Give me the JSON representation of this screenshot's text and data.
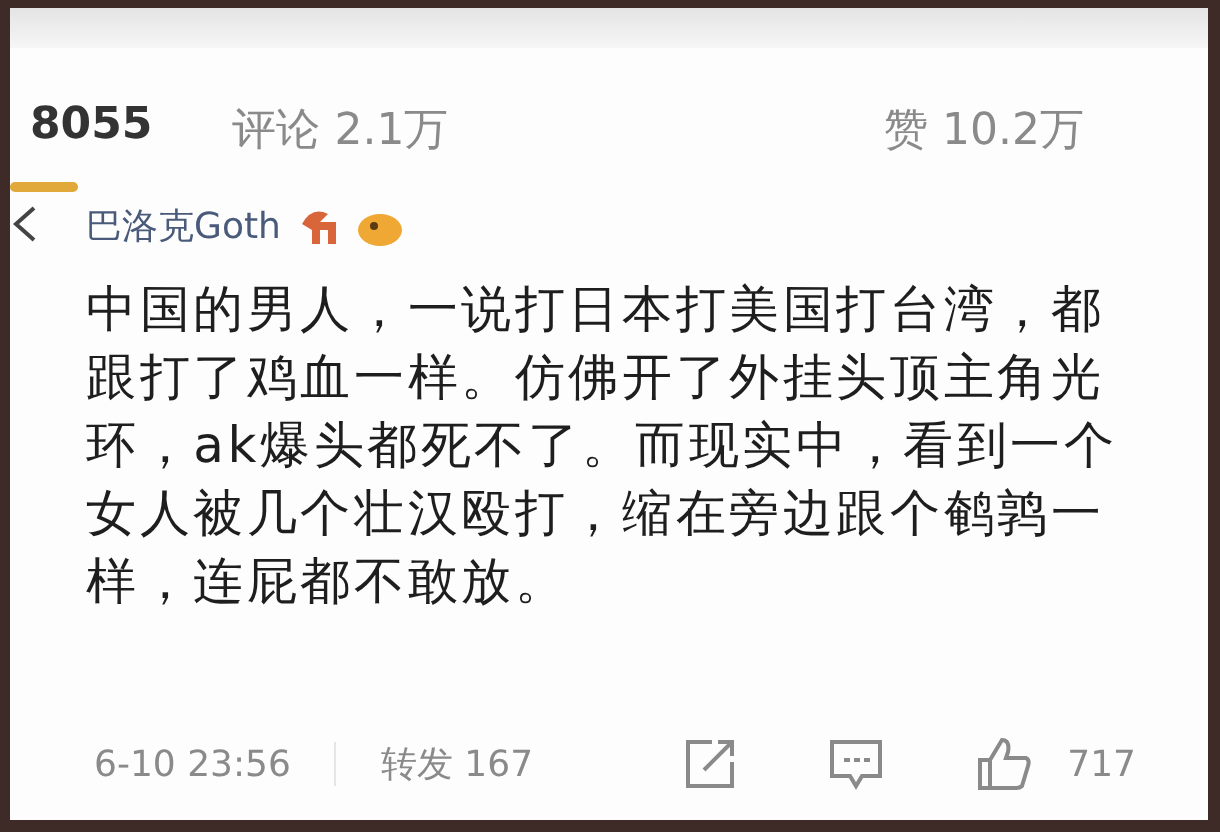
{
  "tabs": [
    {
      "label": "8055",
      "selected": true
    },
    {
      "label": "评论 2.1万",
      "selected": false
    }
  ],
  "likes_tab": {
    "label": "赞 10.2万",
    "selected": false
  },
  "comment": {
    "author": "巴洛克Goth",
    "lines": [
      "中国的男人，一说打日本打美国打台湾，都",
      "跟打了鸡血一样。仿佛开了外挂头顶主角光",
      "环，ak爆头都死不了。而现实中，看到一个",
      "女人被几个壮汉殴打，缩在旁边跟个鹌鹑一",
      "样，连屁都不敢放。"
    ],
    "time": "6-10 23:56",
    "reposts": "转发 167",
    "likes": "717"
  }
}
